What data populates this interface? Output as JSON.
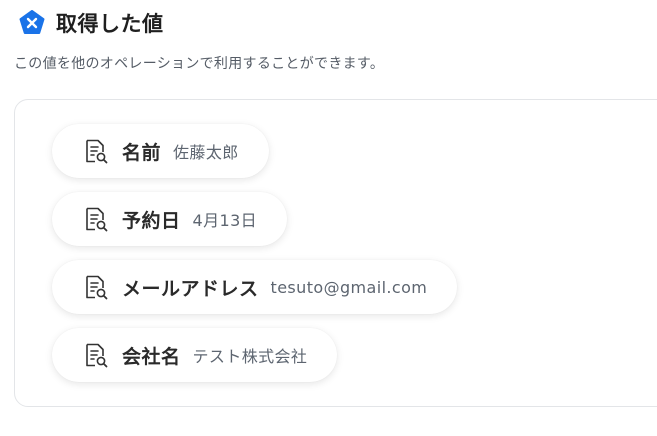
{
  "header": {
    "title": "取得した値",
    "subtitle": "この値を他のオペレーションで利用することができます。",
    "icon": "close-x-pentagon-icon",
    "accent_color": "#1a73e8"
  },
  "fields": [
    {
      "label": "名前",
      "value": "佐藤太郎",
      "icon": "document-search-icon"
    },
    {
      "label": "予約日",
      "value": "4月13日",
      "icon": "document-search-icon"
    },
    {
      "label": "メールアドレス",
      "value": "tesuto@gmail.com",
      "icon": "document-search-icon"
    },
    {
      "label": "会社名",
      "value": "テスト株式会社",
      "icon": "document-search-icon"
    }
  ]
}
